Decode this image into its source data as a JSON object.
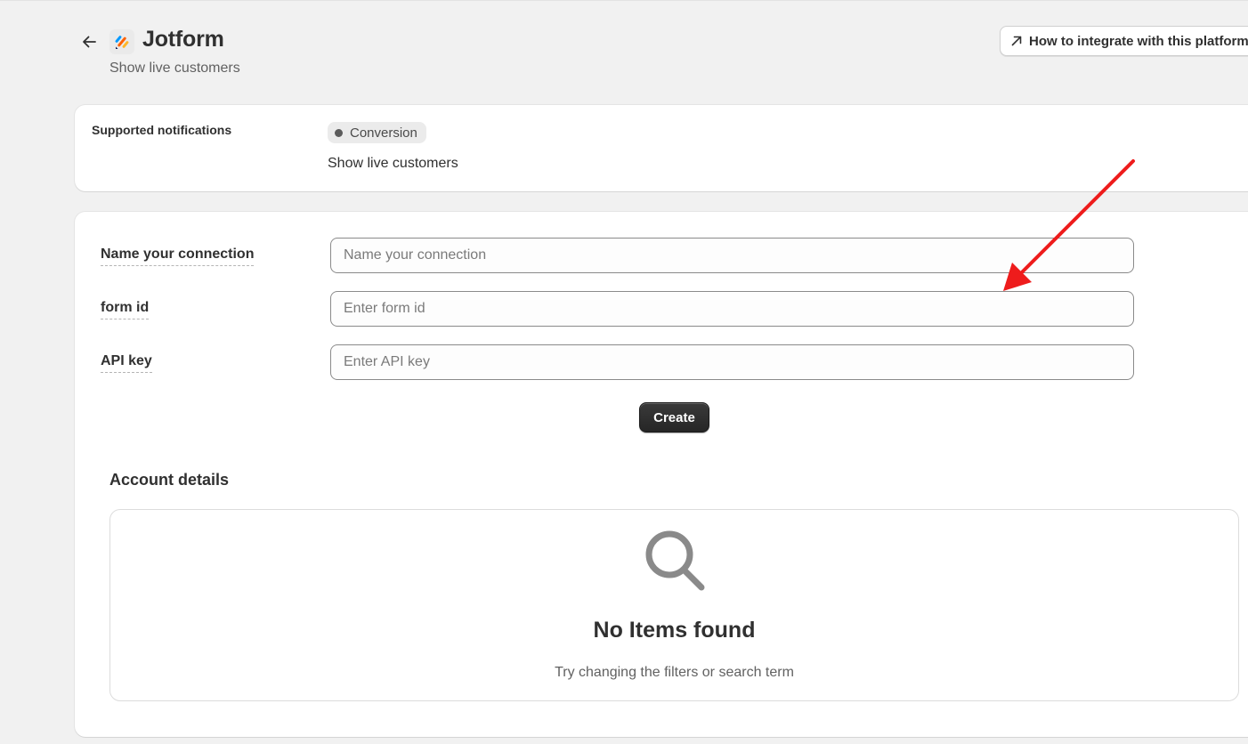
{
  "header": {
    "title": "Jotform",
    "subtitle": "Show live customers",
    "integrate_button_label": "How to integrate with this platform",
    "back_icon": "arrow-left-icon",
    "logo_icon": "jotform-logo-icon",
    "link_icon": "arrow-up-right-icon"
  },
  "notifications": {
    "label": "Supported notifications",
    "badge": "Conversion",
    "description": "Show live customers"
  },
  "form": {
    "fields": [
      {
        "label": "Name your connection",
        "placeholder": "Name your connection",
        "value": ""
      },
      {
        "label": "form id",
        "placeholder": "Enter form id",
        "value": ""
      },
      {
        "label": "API key",
        "placeholder": "Enter API key",
        "value": ""
      }
    ],
    "create_label": "Create"
  },
  "account": {
    "title": "Account details",
    "empty_title": "No Items found",
    "empty_subtitle": "Try changing the filters or search term",
    "empty_icon": "search-icon"
  },
  "colors": {
    "background": "#f1f1f1",
    "card": "#ffffff",
    "primary_button": "#303030",
    "annotation_arrow": "#ee1c1c",
    "logo_blue": "#0a1551",
    "logo_orange": "#ff6100",
    "logo_yellow": "#ffb629",
    "logo_light_blue": "#0099ff"
  }
}
